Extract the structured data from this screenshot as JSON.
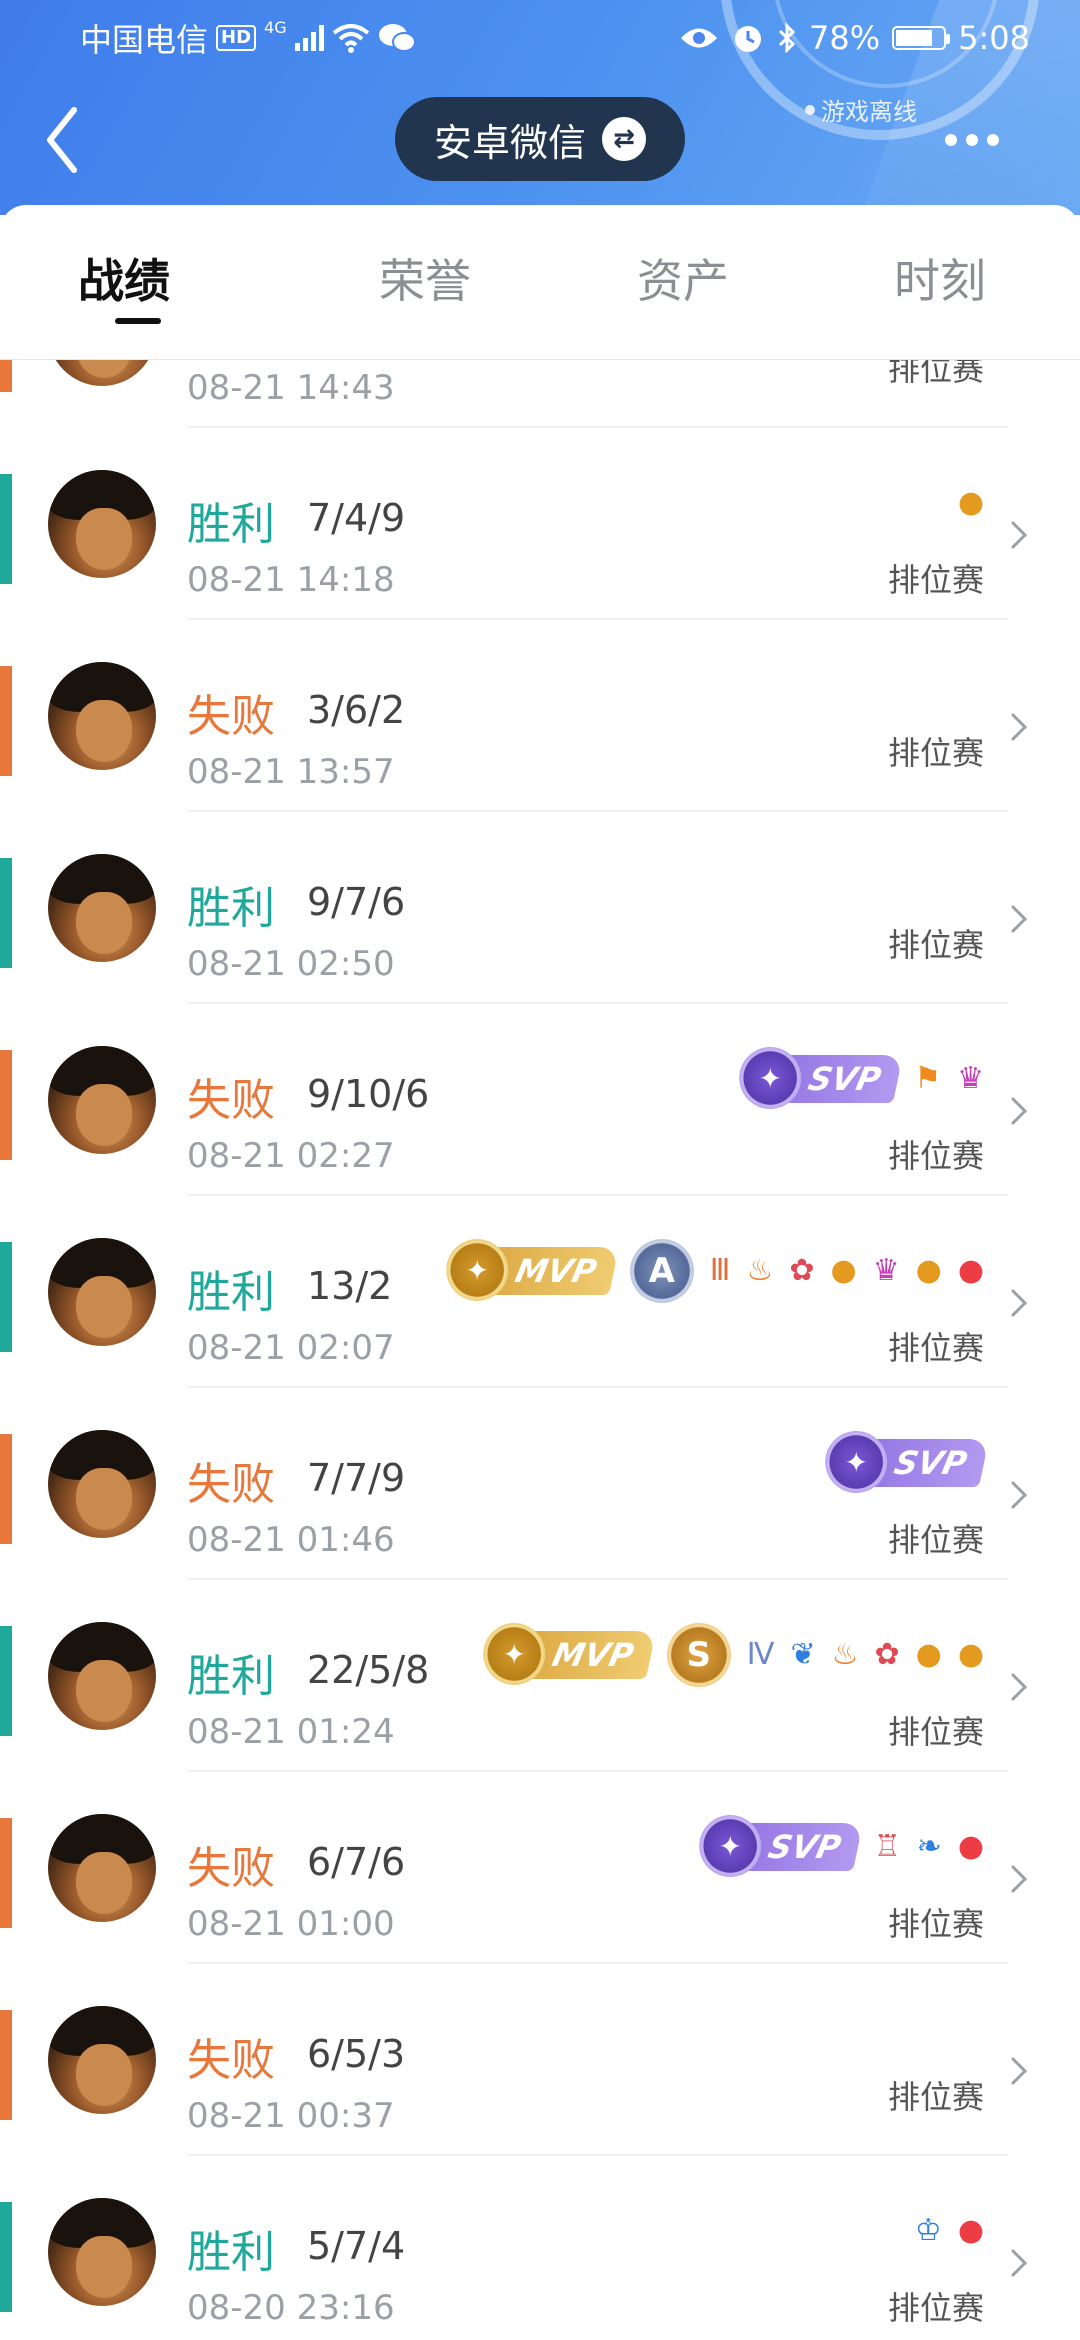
{
  "status_bar": {
    "carrier": "中国电信",
    "hd": "HD",
    "network": "4G",
    "battery": "78%",
    "battery_level": 0.78,
    "time": "5:08"
  },
  "header": {
    "account": "安卓微信",
    "swap_symbol": "⇄",
    "offline": "游戏离线"
  },
  "tabs": [
    {
      "label": "战绩",
      "active": true
    },
    {
      "label": "荣誉",
      "active": false
    },
    {
      "label": "资产",
      "active": false
    },
    {
      "label": "时刻",
      "active": false
    }
  ],
  "colors": {
    "win": "#1fa99a",
    "loss": "#e8773c",
    "svp": "#9b7be6",
    "mvp": "#e0ad48"
  },
  "matches": [
    {
      "result": "",
      "kda": "",
      "time": "08-21 14:43",
      "mode": "排位赛",
      "outcome": "loss",
      "medal": "",
      "grade": "",
      "icons": []
    },
    {
      "result": "胜利",
      "kda": "7/4/9",
      "time": "08-21 14:18",
      "mode": "排位赛",
      "outcome": "win",
      "medal": "",
      "grade": "",
      "icons": [
        "gold-coins"
      ]
    },
    {
      "result": "失败",
      "kda": "3/6/2",
      "time": "08-21 13:57",
      "mode": "排位赛",
      "outcome": "loss",
      "medal": "",
      "grade": "",
      "icons": []
    },
    {
      "result": "胜利",
      "kda": "9/7/6",
      "time": "08-21 02:50",
      "mode": "排位赛",
      "outcome": "win",
      "medal": "",
      "grade": "",
      "icons": []
    },
    {
      "result": "失败",
      "kda": "9/10/6",
      "time": "08-21 02:27",
      "mode": "排位赛",
      "outcome": "loss",
      "medal": "SVP",
      "grade": "",
      "icons": [
        "flag",
        "demon"
      ]
    },
    {
      "result": "胜利",
      "kda": "13/2",
      "time": "08-21 02:07",
      "mode": "排位赛",
      "outcome": "win",
      "medal": "MVP",
      "grade": "A",
      "icons": [
        "triple-kill",
        "fire",
        "lotus",
        "gold-coins",
        "demon",
        "gold-coins",
        "blood-drop"
      ]
    },
    {
      "result": "失败",
      "kda": "7/7/9",
      "time": "08-21 01:46",
      "mode": "排位赛",
      "outcome": "loss",
      "medal": "SVP",
      "grade": "",
      "icons": []
    },
    {
      "result": "胜利",
      "kda": "22/5/8",
      "time": "08-21 01:24",
      "mode": "排位赛",
      "outcome": "win",
      "medal": "MVP",
      "grade": "S",
      "icons": [
        "quadra-kill",
        "dragon",
        "fire",
        "lotus",
        "gold-coins",
        "gold-coins"
      ]
    },
    {
      "result": "失败",
      "kda": "6/7/6",
      "time": "08-21 01:00",
      "mode": "排位赛",
      "outcome": "loss",
      "medal": "SVP",
      "grade": "",
      "icons": [
        "tower",
        "wings",
        "blood-drop"
      ]
    },
    {
      "result": "失败",
      "kda": "6/5/3",
      "time": "08-21 00:37",
      "mode": "排位赛",
      "outcome": "loss",
      "medal": "",
      "grade": "",
      "icons": []
    },
    {
      "result": "胜利",
      "kda": "5/7/4",
      "time": "08-20 23:16",
      "mode": "排位赛",
      "outcome": "win",
      "medal": "",
      "grade": "",
      "icons": [
        "helmet",
        "blood-drop"
      ]
    }
  ]
}
